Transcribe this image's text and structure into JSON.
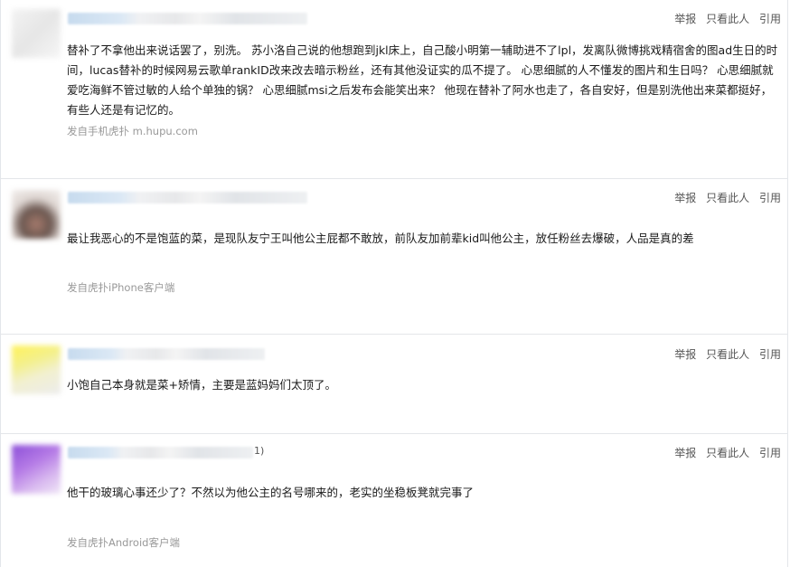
{
  "posts": [
    {
      "actions": {
        "report": "举报",
        "only_author": "只看此人",
        "quote": "引用"
      },
      "content": "替补了不拿他出来说话罢了，别洗。 苏小洛自己说的他想跑到jkl床上，自己酸小明第一辅助进不了lpl，发离队微博挑戏精宿舍的图ad生日的时间，lucas替补的时候网易云歌单rankID改来改去暗示粉丝，还有其他没证实的瓜不提了。 心思细腻的人不懂发的图片和生日吗？ 心思细腻就爱吃海鲜不管过敏的人给个单独的锅？ 心思细腻msi之后发布会能笑出来？ 他现在替补了阿水也走了，各自安好，但是别洗他出来菜都挺好，有些人还是有记忆的。",
      "source": "发自手机虎扑 m.hupu.com"
    },
    {
      "actions": {
        "report": "举报",
        "only_author": "只看此人",
        "quote": "引用"
      },
      "content": "最让我恶心的不是饱蓝的菜，是现队友宁王叫他公主屁都不敢放，前队友加前辈kid叫他公主，放任粉丝去爆破，人品是真的差",
      "source": "发自虎扑iPhone客户端"
    },
    {
      "actions": {
        "report": "举报",
        "only_author": "只看此人",
        "quote": "引用"
      },
      "content": "小饱自己本身就是菜+矫情，主要是蓝妈妈们太顶了。",
      "source": ""
    },
    {
      "actions": {
        "report": "举报",
        "only_author": "只看此人",
        "quote": "引用"
      },
      "meta_suffix": "1)",
      "content": "他干的玻璃心事还少了？不然以为他公主的名号哪来的，老实的坐稳板凳就完事了",
      "source": "发自虎扑Android客户端"
    }
  ]
}
